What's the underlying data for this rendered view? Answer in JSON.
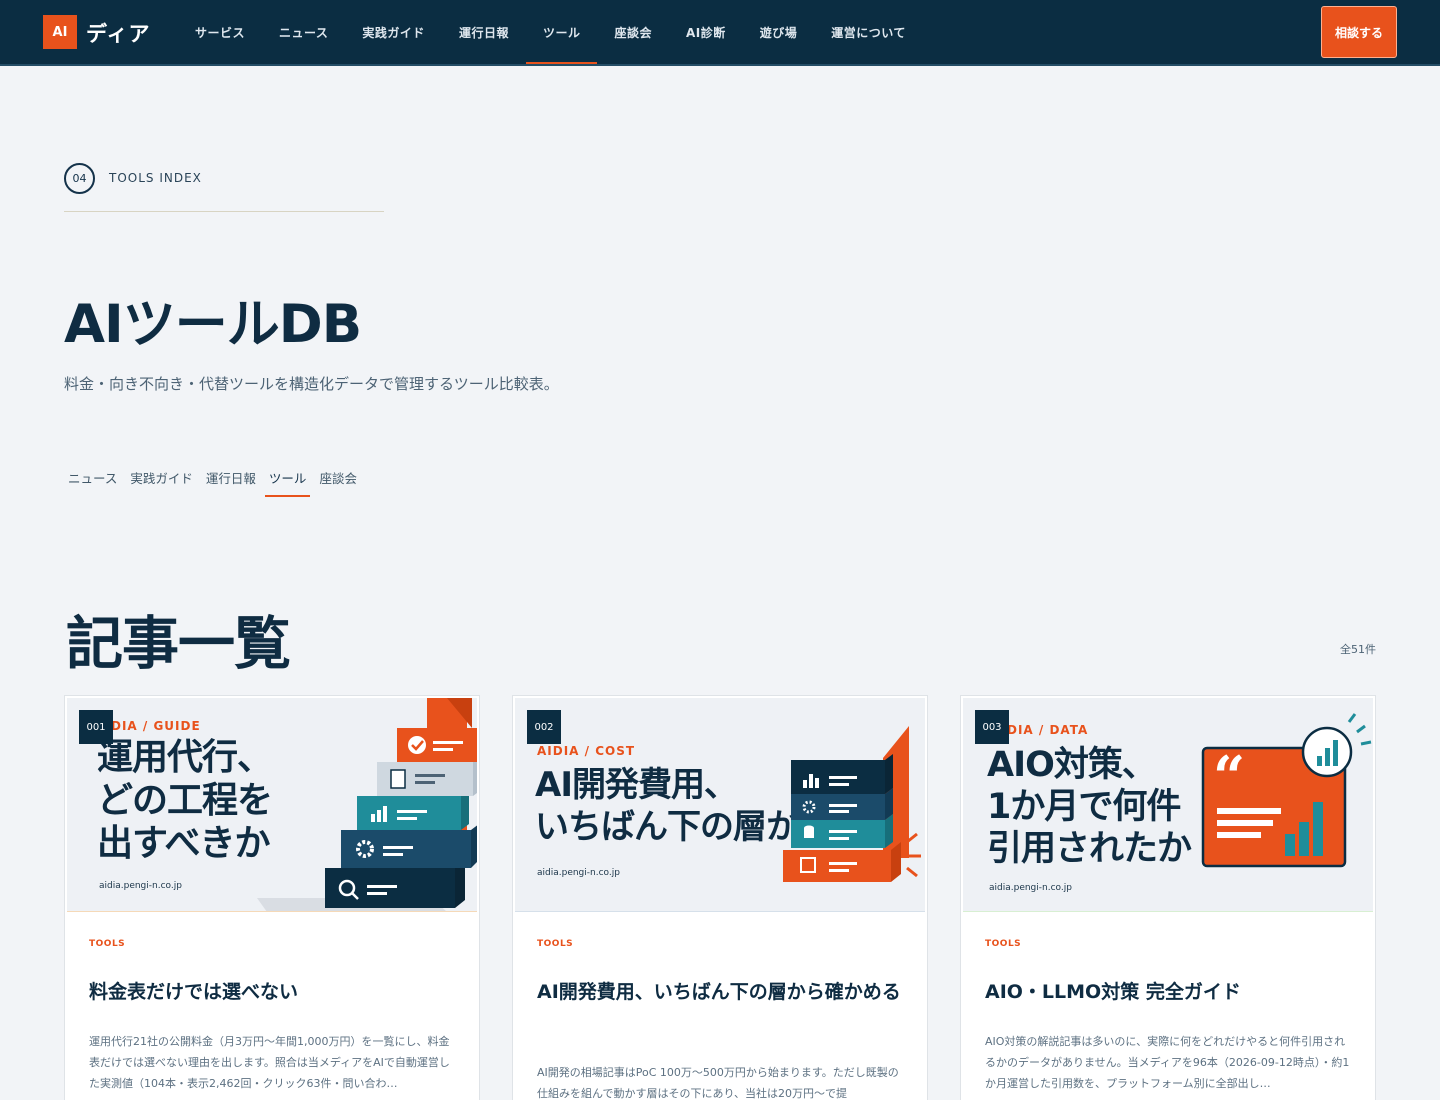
{
  "header": {
    "logo_mark": "AI",
    "logo_text": "ディア",
    "nav": [
      "サービス",
      "ニュース",
      "実践ガイド",
      "運行日報",
      "ツール",
      "座談会",
      "AI診断",
      "遊び場",
      "運営について"
    ],
    "active_nav": "ツール",
    "cta_label": "相談する"
  },
  "hero": {
    "section_number": "04",
    "section_label": "TOOLS INDEX",
    "title": "AIツールDB",
    "description": "料金・向き不向き・代替ツールを構造化データで管理するツール比較表。",
    "subnav": [
      "ニュース",
      "実践ガイド",
      "運行日報",
      "ツール",
      "座談会"
    ],
    "active_subnav": "ツール"
  },
  "list": {
    "title": "記事一覧",
    "count": "全51件"
  },
  "cards": [
    {
      "number": "001",
      "thumb_kicker": "DIA / GUIDE",
      "thumb_headline": "運用代行、\nどの工程を\n出すべきか",
      "thumb_domain": "aidia.pengi-n.co.jp",
      "category": "TOOLS",
      "title": "料金表だけでは選べない",
      "excerpt": "運用代行21社の公開料金（月3万円〜年間1,000万円）を一覧にし、料金表だけでは選べない理由を出します。照合は当メディアをAIで自動運営した実測値（104本・表示2,462回・クリック63件・問い合わ…"
    },
    {
      "number": "002",
      "thumb_kicker": "AIDIA / COST",
      "thumb_headline": "AI開発費用、\nいちばん下の層から",
      "thumb_domain": "aidia.pengi-n.co.jp",
      "category": "TOOLS",
      "title": "AI開発費用、いちばん下の層から確かめる",
      "excerpt": "AI開発の相場記事はPoC 100万〜500万円から始まります。ただし既製の仕組みを組んで動かす層はその下にあり、当社は20万円〜で提"
    },
    {
      "number": "003",
      "thumb_kicker": "DIA / DATA",
      "thumb_headline": "AIO対策、\n1か月で何件\n引用されたか",
      "thumb_domain": "aidia.pengi-n.co.jp",
      "category": "TOOLS",
      "title": "AIO・LLMO対策 完全ガイド",
      "excerpt": "AIO対策の解説記事は多いのに、実際に何をどれだけやると何件引用されるかのデータがありません。当メディアを96本（2026-09-12時点）・約1か月運営した引用数を、プラットフォーム別に全部出し…"
    }
  ],
  "colors": {
    "navy": "#0b2d42",
    "accent": "#e8521c",
    "teal": "#1f8d9a",
    "background": "#f2f4f7"
  }
}
